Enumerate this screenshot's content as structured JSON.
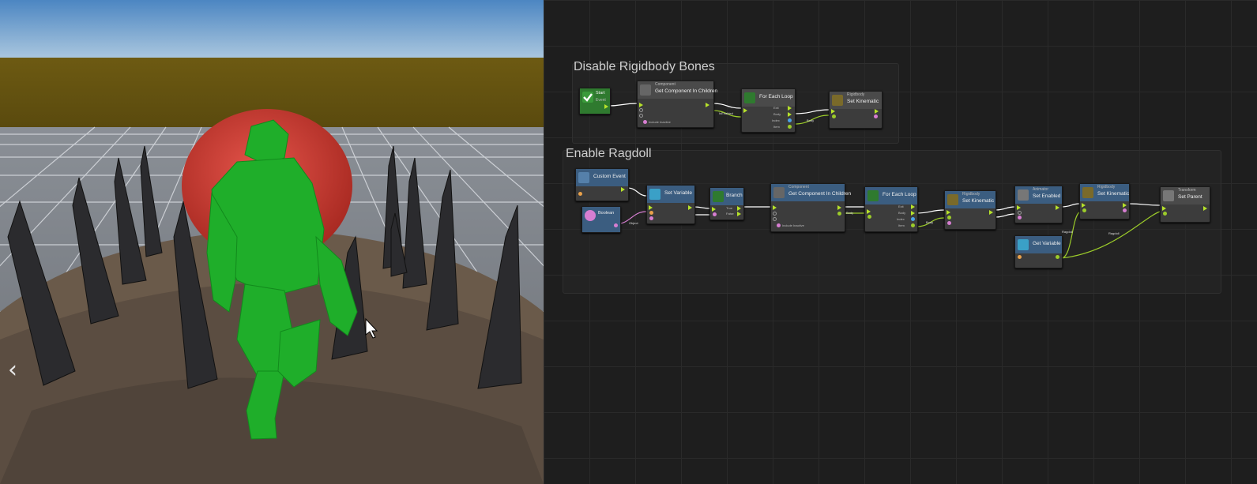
{
  "viewport": {
    "nav_prev_glyph": "‹"
  },
  "graph": {
    "groups": [
      {
        "title": "Disable Rigidbody Bones"
      },
      {
        "title": "Enable Ragdoll"
      }
    ],
    "nodes": {
      "start": {
        "title": "Start",
        "sub": "Event"
      },
      "gcic1": {
        "category": "Component",
        "title": "Get Component In Children",
        "pin": "Include Inactive"
      },
      "foreach1": {
        "title": "For Each Loop",
        "pins": [
          "Exit",
          "Body",
          "Index",
          "Item"
        ]
      },
      "setkin1": {
        "category": "Rigidbody",
        "title": "Set Kinematic"
      },
      "custom": {
        "title": "Custom Event"
      },
      "boolean": {
        "title": "Boolean"
      },
      "setvar": {
        "title": "Set Variable"
      },
      "branch": {
        "title": "Branch",
        "pins": [
          "True",
          "False"
        ]
      },
      "gcic2": {
        "category": "Component",
        "title": "Get Component In Children",
        "pin": "Include Inactive"
      },
      "foreach2": {
        "title": "For Each Loop",
        "pins": [
          "Exit",
          "Body",
          "Index",
          "Item"
        ]
      },
      "setkin2": {
        "category": "Rigidbody",
        "title": "Set Kinematic"
      },
      "animator": {
        "category": "Animator",
        "title": "Set Enabled"
      },
      "setkin3": {
        "category": "Rigidbody",
        "title": "Set Kinematic"
      },
      "transform": {
        "category": "Transform",
        "title": "Set Parent"
      },
      "getvar": {
        "title": "Get Variable"
      }
    },
    "wire_labels": {
      "w1": "IsEnabled",
      "w2": "Body",
      "w3": "Object",
      "w4": "Body",
      "w5": "Body",
      "w6": "Ragdoll",
      "w7": "Ragdoll"
    }
  },
  "colors": {
    "accent_flow": "#b6e22a",
    "node_blue": "#3b5d80",
    "node_green": "#2f7a2f",
    "ball": "#d53b2f",
    "character": "#1fae2a"
  }
}
